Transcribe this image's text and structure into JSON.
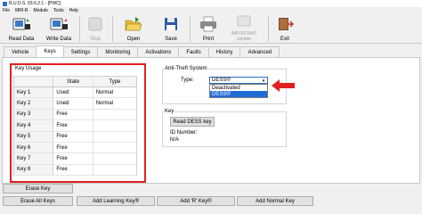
{
  "window": {
    "title": "R.U.D.S. 03.6.2.1 - [PWC]"
  },
  "menu": [
    "File",
    "MRI-R",
    "Module",
    "Tools",
    "Help"
  ],
  "toolbar": {
    "read_data": "Read Data",
    "write_data": "Write Data",
    "stop": "Stop",
    "open": "Open",
    "save": "Save",
    "print": "Print",
    "important_update_1": "IMPORTANT",
    "important_update_2": "Update",
    "exit": "Exit"
  },
  "tabs": [
    "Vehicle",
    "Keys",
    "Settings",
    "Monitoring",
    "Activations",
    "Faults",
    "History",
    "Advanced"
  ],
  "active_tab": "Keys",
  "key_usage": {
    "title": "Key Usage",
    "columns": [
      "State",
      "Type"
    ],
    "rows": [
      {
        "key": "Key 1",
        "state": "Used",
        "type": "Normal"
      },
      {
        "key": "Key 2",
        "state": "Used",
        "type": "Normal"
      },
      {
        "key": "Key 3",
        "state": "Free",
        "type": ""
      },
      {
        "key": "Key 4",
        "state": "Free",
        "type": ""
      },
      {
        "key": "Key 5",
        "state": "Free",
        "type": ""
      },
      {
        "key": "Key 6",
        "state": "Free",
        "type": ""
      },
      {
        "key": "Key 7",
        "state": "Free",
        "type": ""
      },
      {
        "key": "Key 8",
        "state": "Free",
        "type": ""
      }
    ]
  },
  "anti_theft": {
    "title": "Anti-Theft System",
    "type_label": "Type:",
    "selected": "DESS®",
    "options": [
      "Deactivated",
      "DESS®"
    ]
  },
  "key_group": {
    "title": "Key",
    "read_button": "Read DESS key",
    "id_label": "ID Number:",
    "id_value": "N/A"
  },
  "buttons": {
    "erase_key": "Erase Key",
    "erase_all": "Erase All Keys",
    "add_learning": "Add Learning Key®",
    "add_r": "Add 'R' Key®",
    "add_normal": "Add Normal Key"
  },
  "colors": {
    "highlight": "#e02020",
    "selection": "#1e6bd6"
  }
}
